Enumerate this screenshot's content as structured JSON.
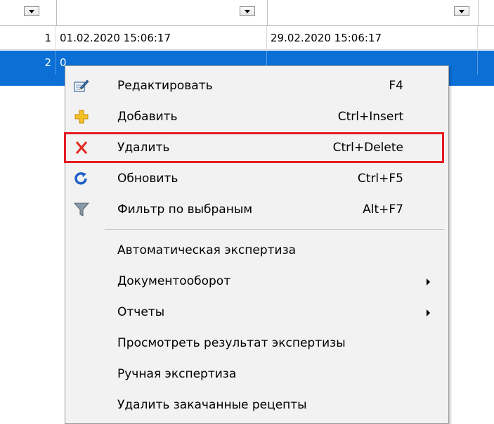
{
  "grid": {
    "rows": [
      {
        "index": "1",
        "start": "01.02.2020 15:06:17",
        "end": "29.02.2020 15:06:17"
      },
      {
        "index": "2",
        "start": "0",
        "end": ""
      }
    ]
  },
  "context_menu": {
    "items": [
      {
        "label": "Редактировать",
        "shortcut": "F4",
        "icon": "edit-icon"
      },
      {
        "label": "Добавить",
        "shortcut": "Ctrl+Insert",
        "icon": "add-icon"
      },
      {
        "label": "Удалить",
        "shortcut": "Ctrl+Delete",
        "icon": "delete-icon"
      },
      {
        "label": "Обновить",
        "shortcut": "Ctrl+F5",
        "icon": "refresh-icon"
      },
      {
        "label": "Фильтр по выбраным",
        "shortcut": "Alt+F7",
        "icon": "filter-icon"
      }
    ],
    "items2": [
      {
        "label": "Автоматическая экспертиза"
      },
      {
        "label": "Документооборот",
        "submenu": true
      },
      {
        "label": "Отчеты",
        "submenu": true
      },
      {
        "label": "Просмотреть результат экспертизы"
      },
      {
        "label": "Ручная экспертиза"
      },
      {
        "label": "Удалить закачанные рецепты"
      }
    ]
  },
  "colors": {
    "selection": "#0b6fd6",
    "highlight": "#e61b23"
  }
}
